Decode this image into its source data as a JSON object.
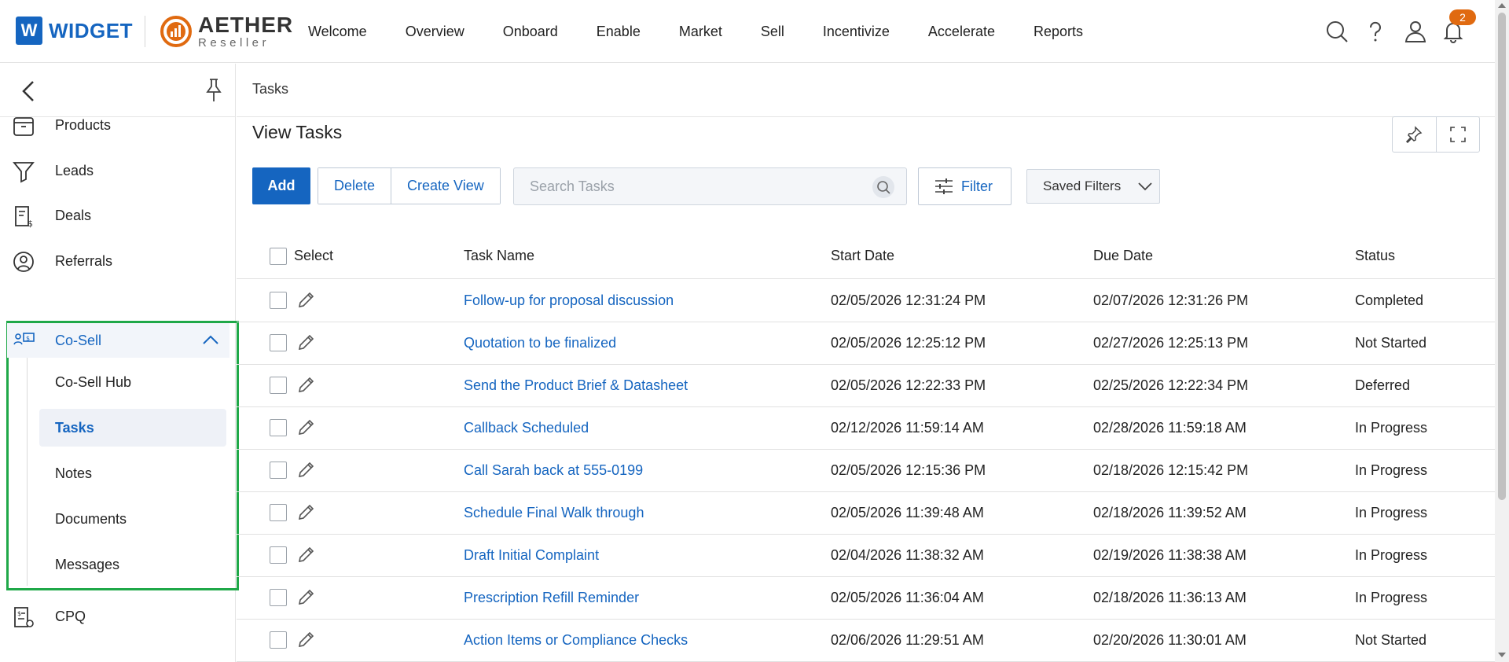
{
  "header": {
    "logo_widget_letter": "W",
    "logo_widget_text": "WIDGET",
    "logo_aether_text": "AETHER",
    "logo_aether_sub": "Reseller",
    "nav": [
      "Welcome",
      "Overview",
      "Onboard",
      "Enable",
      "Market",
      "Sell",
      "Incentivize",
      "Accelerate",
      "Reports"
    ],
    "notification_count": "2",
    "icons": [
      "search-icon",
      "help-icon",
      "user-icon",
      "bell-icon"
    ]
  },
  "sidebar": {
    "items": [
      {
        "label": "Products",
        "icon": "box-icon"
      },
      {
        "label": "Leads",
        "icon": "funnel-icon"
      },
      {
        "label": "Deals",
        "icon": "deal-document-icon"
      },
      {
        "label": "Referrals",
        "icon": "referral-user-icon"
      }
    ],
    "cosell": {
      "label": "Co-Sell",
      "icon": "co-sell-icon",
      "sub_items": [
        "Co-Sell Hub",
        "Tasks",
        "Notes",
        "Documents",
        "Messages"
      ],
      "active": "Tasks"
    },
    "after_items": [
      {
        "label": "CPQ",
        "icon": "cpq-icon"
      }
    ]
  },
  "main": {
    "breadcrumb": "Tasks",
    "title": "View Tasks",
    "toolbar": {
      "add_label": "Add",
      "delete_label": "Delete",
      "create_view_label": "Create View",
      "search_placeholder": "Search Tasks",
      "filter_label": "Filter",
      "saved_filters_label": "Saved Filters"
    },
    "table": {
      "columns": [
        "Select",
        "Task Name",
        "Start Date",
        "Due Date",
        "Status"
      ],
      "rows": [
        {
          "name": "Follow-up for proposal discussion",
          "start": "02/05/2026 12:31:24 PM",
          "due": "02/07/2026 12:31:26 PM",
          "status": "Completed"
        },
        {
          "name": "Quotation to be finalized",
          "start": "02/05/2026 12:25:12 PM",
          "due": "02/27/2026 12:25:13 PM",
          "status": "Not Started"
        },
        {
          "name": "Send the Product Brief & Datasheet",
          "start": "02/05/2026 12:22:33 PM",
          "due": "02/25/2026 12:22:34 PM",
          "status": "Deferred"
        },
        {
          "name": "Callback Scheduled",
          "start": "02/12/2026 11:59:14 AM",
          "due": "02/28/2026 11:59:18 AM",
          "status": "In Progress"
        },
        {
          "name": "Call Sarah back at 555-0199",
          "start": "02/05/2026 12:15:36 PM",
          "due": "02/18/2026 12:15:42 PM",
          "status": "In Progress"
        },
        {
          "name": "Schedule Final Walk through",
          "start": "02/05/2026 11:39:48 AM",
          "due": "02/18/2026 11:39:52 AM",
          "status": "In Progress"
        },
        {
          "name": "Draft Initial Complaint",
          "start": "02/04/2026 11:38:32 AM",
          "due": "02/19/2026 11:38:38 AM",
          "status": "In Progress"
        },
        {
          "name": "Prescription Refill Reminder",
          "start": "02/05/2026 11:36:04 AM",
          "due": "02/18/2026 11:36:13 AM",
          "status": "In Progress"
        },
        {
          "name": "Action Items or Compliance Checks",
          "start": "02/06/2026 11:29:51 AM",
          "due": "02/20/2026 11:30:01 AM",
          "status": "Not Started"
        }
      ]
    }
  },
  "colors": {
    "brand_blue": "#1565c0",
    "aether_orange": "#e06a10",
    "highlight_green": "#1fa848"
  }
}
